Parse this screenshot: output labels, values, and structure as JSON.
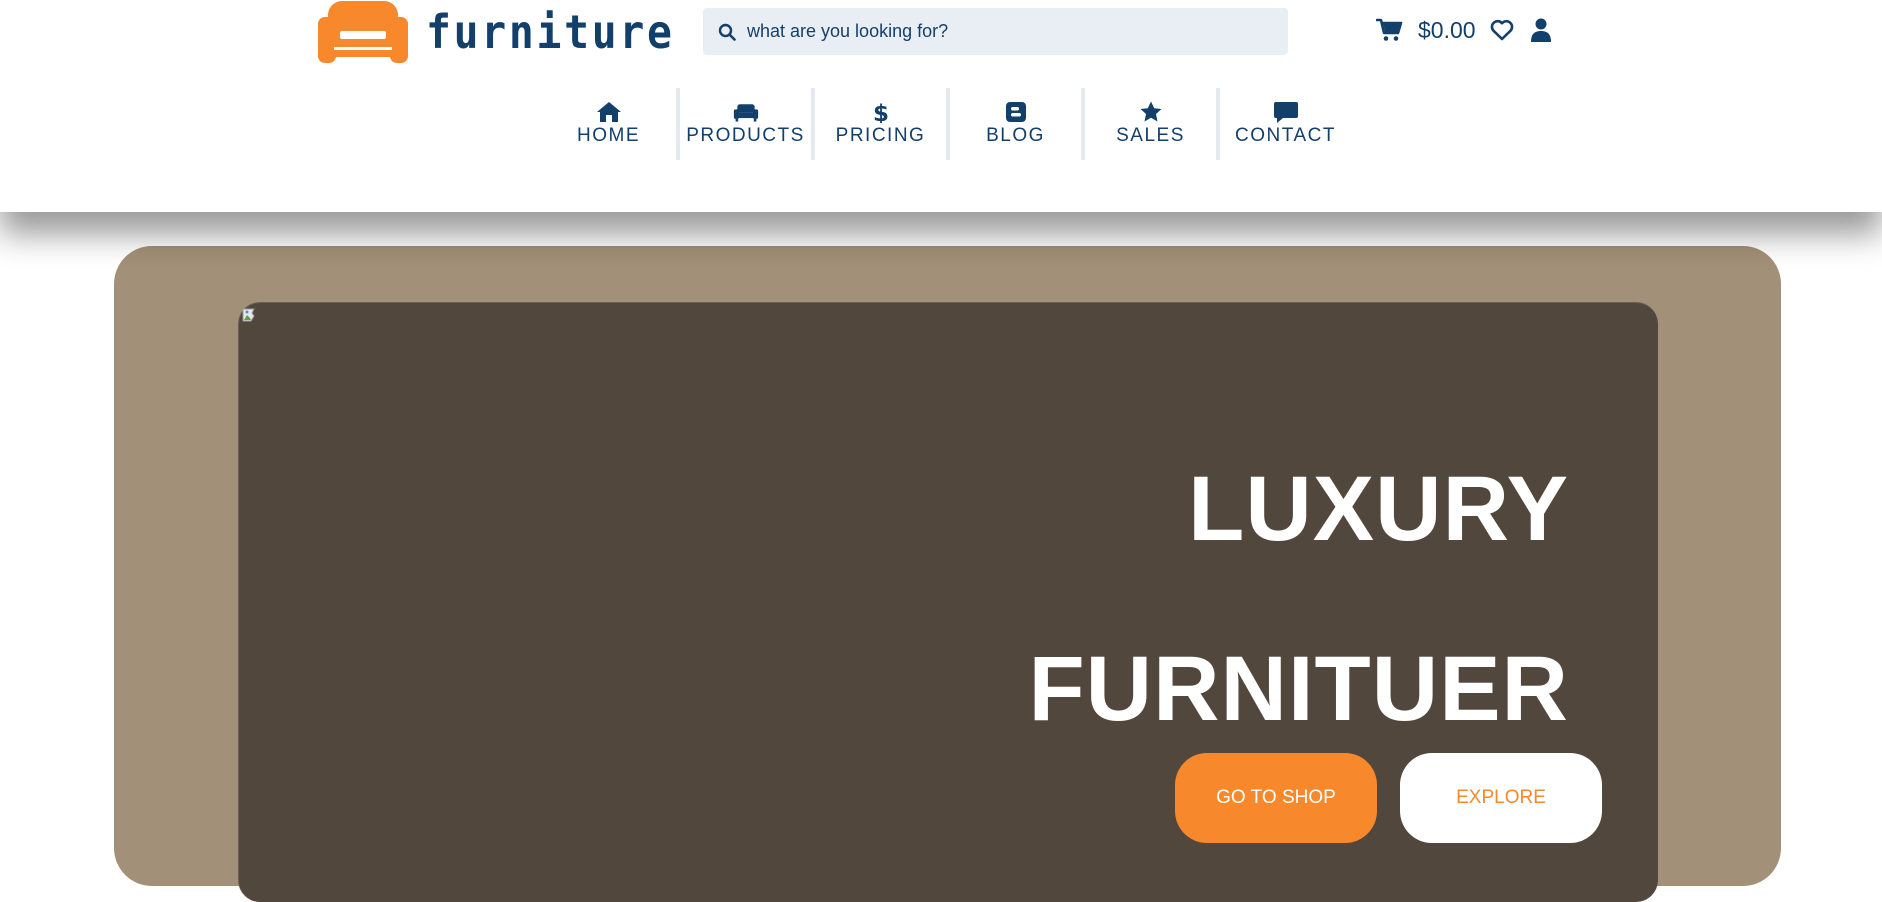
{
  "brand": {
    "name": "furniture",
    "accent_color": "#f7882b",
    "primary_color": "#133f6b"
  },
  "search": {
    "placeholder": "what are you looking for?",
    "value": "",
    "icon": "search-icon"
  },
  "utility": {
    "cart_total": "$0.00",
    "cart_icon": "cart-icon",
    "wishlist_icon": "heart-icon",
    "account_icon": "user-icon"
  },
  "nav": {
    "items": [
      {
        "label": "HOME",
        "icon": "home-icon"
      },
      {
        "label": "PRODUCTS",
        "icon": "sofa-icon"
      },
      {
        "label": "PRICING",
        "icon": "dollar-icon"
      },
      {
        "label": "BLOG",
        "icon": "blogger-icon"
      },
      {
        "label": "SALES",
        "icon": "star-icon"
      },
      {
        "label": "CONTACT",
        "icon": "comment-icon"
      }
    ]
  },
  "hero": {
    "title_line1": "LUXURY",
    "title_line2": "FURNITUER",
    "primary_button": "GO TO SHOP",
    "secondary_button": "EXPLORE",
    "outer_color": "#a39078",
    "inner_color": "#52473d"
  }
}
